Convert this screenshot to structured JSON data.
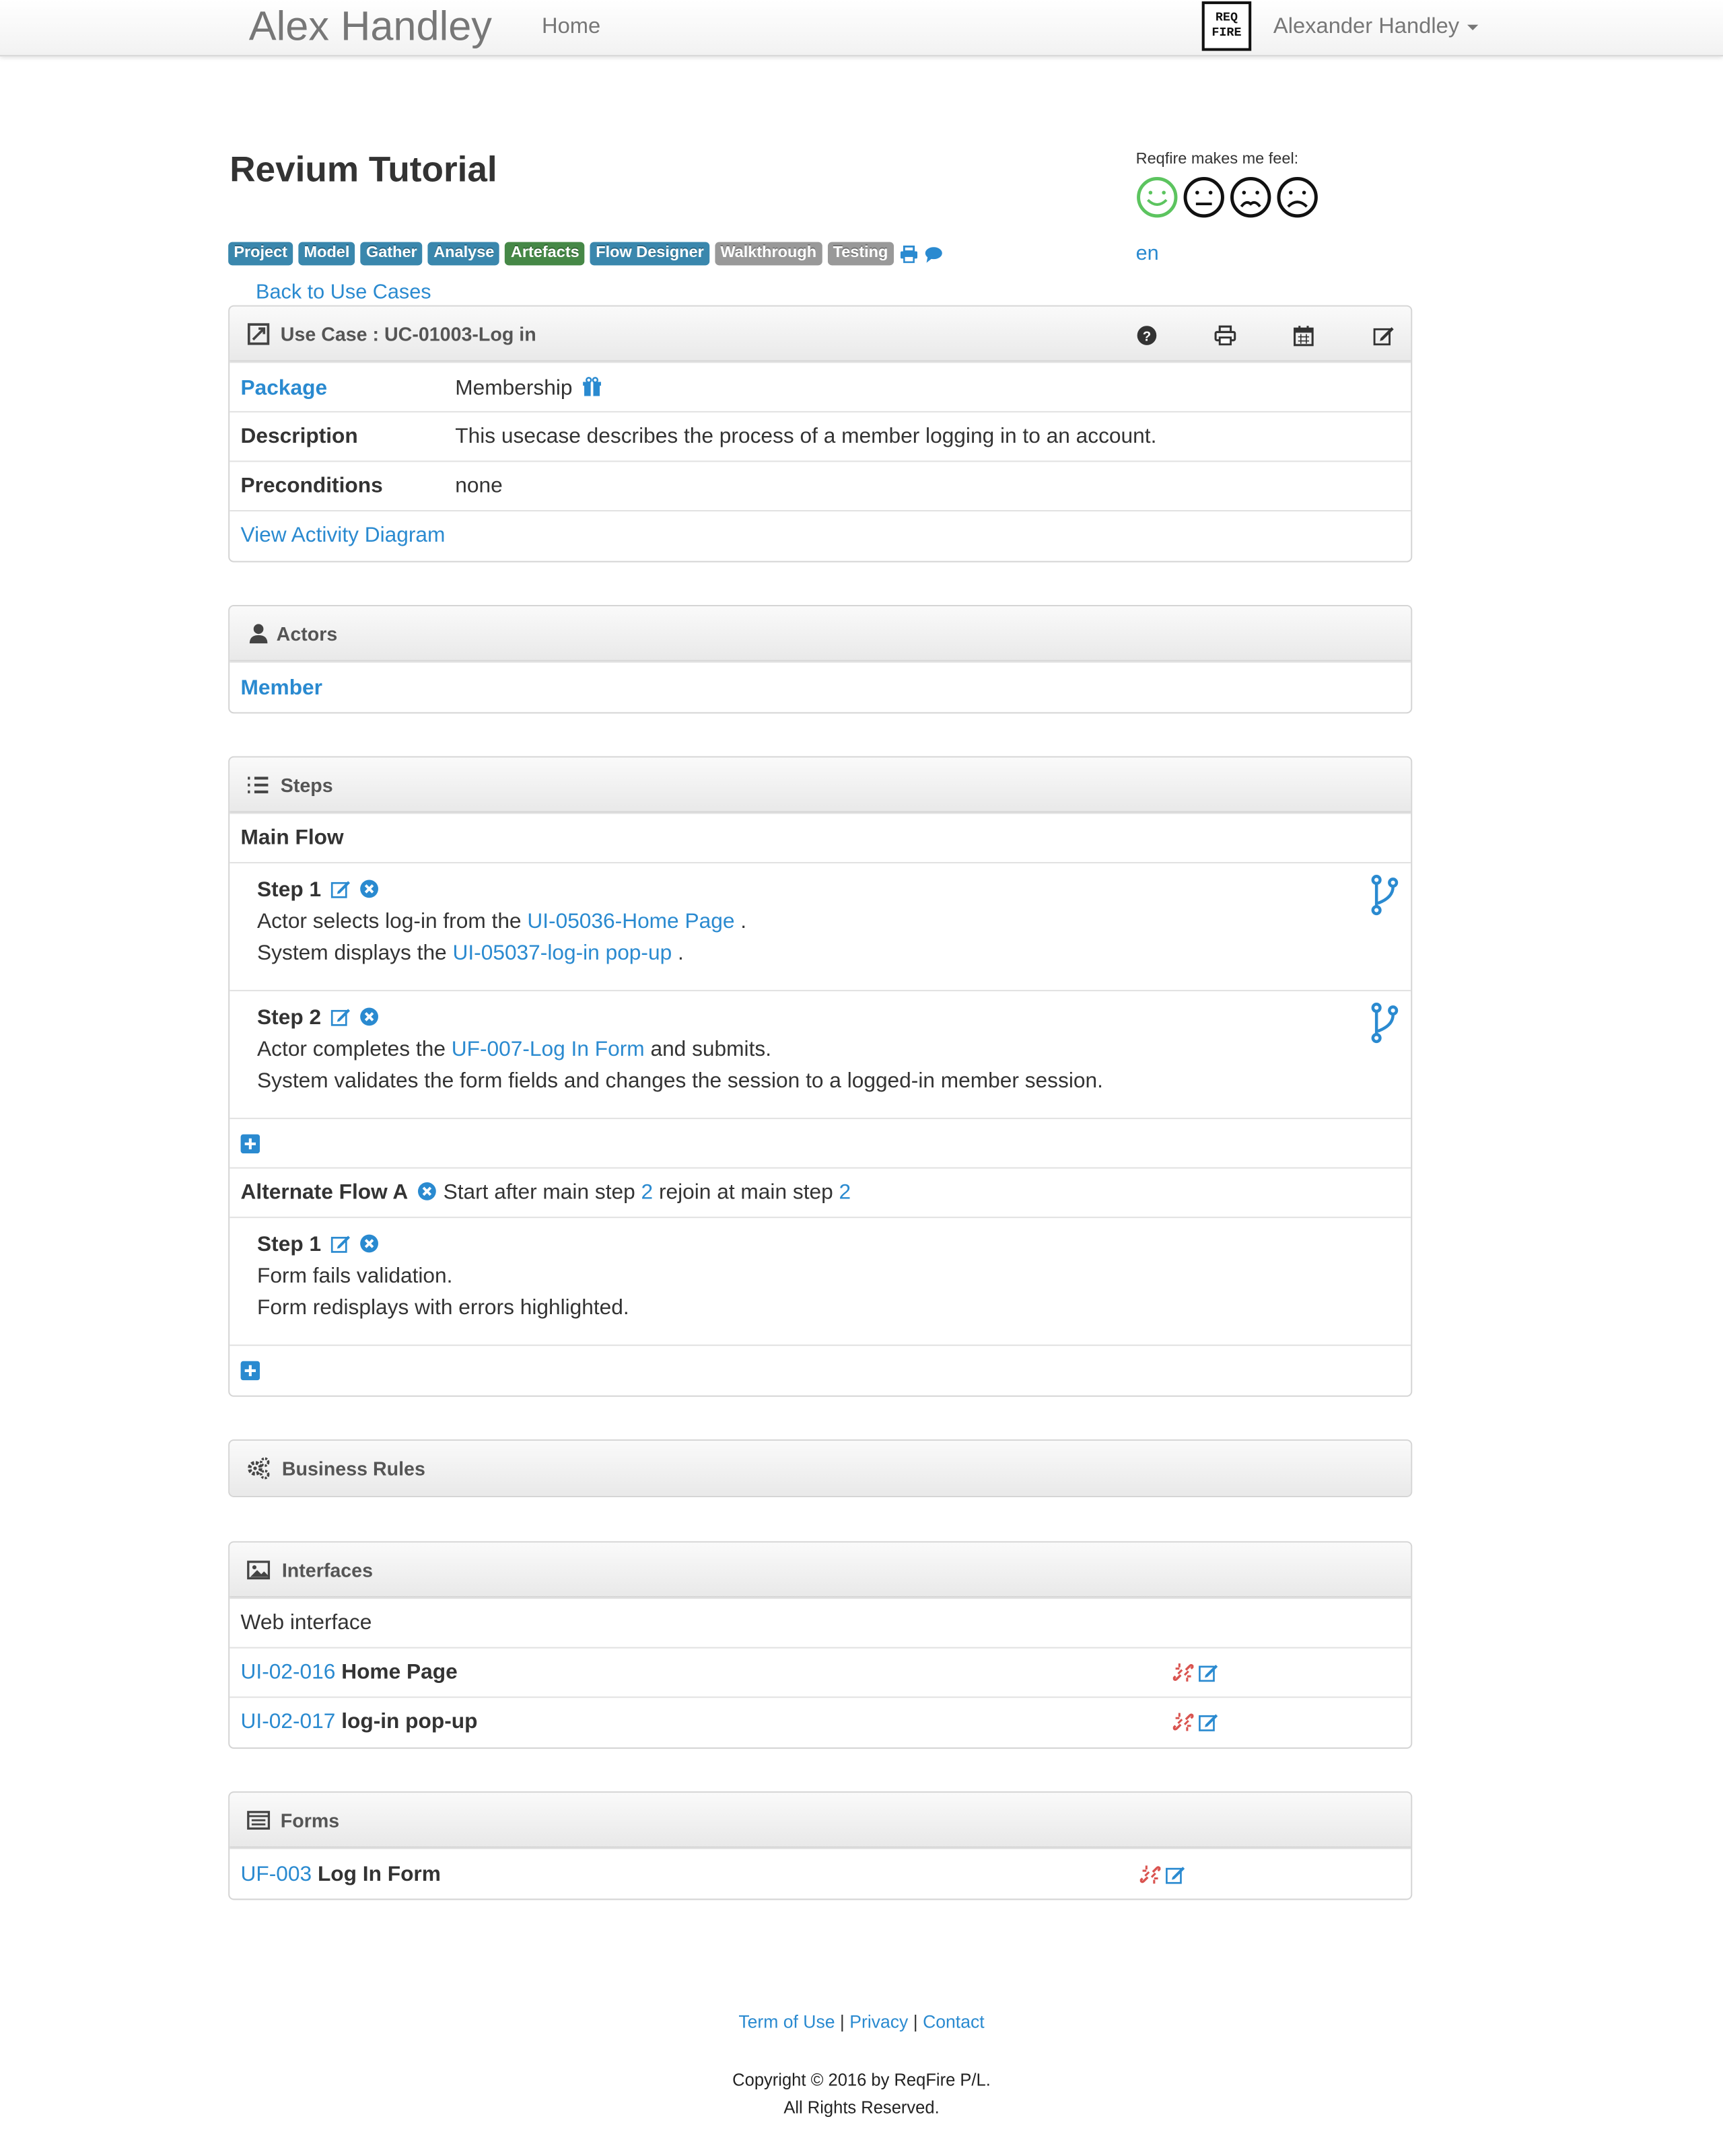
{
  "navbar": {
    "brand": "Alex Handley",
    "home": "Home",
    "logo_text_top": "REQ",
    "logo_text_bottom": "FIRE",
    "user": "Alexander Handley"
  },
  "page": {
    "title": "Revium Tutorial",
    "feel_label": "Reqfire makes me feel:",
    "language": "en",
    "back_link": "Back to Use Cases"
  },
  "labels": [
    {
      "text": "Project",
      "color": "#3a87ad"
    },
    {
      "text": "Model",
      "color": "#3a87ad"
    },
    {
      "text": "Gather",
      "color": "#3a87ad"
    },
    {
      "text": "Analyse",
      "color": "#3a87ad"
    },
    {
      "text": "Artefacts",
      "color": "#468847"
    },
    {
      "text": "Flow Designer",
      "color": "#3a87ad"
    },
    {
      "text": "Walkthrough",
      "color": "#999999"
    },
    {
      "text": "Testing",
      "color": "#999999"
    }
  ],
  "usecase": {
    "header": "Use Case : UC-01003-Log in",
    "package_label": "Package",
    "package_value": "Membership",
    "description_label": "Description",
    "description_value": "This usecase describes the process of a member logging in to an account.",
    "preconditions_label": "Preconditions",
    "preconditions_value": "none",
    "activity_link": "View Activity Diagram"
  },
  "actors": {
    "header": "Actors",
    "member": "Member"
  },
  "steps": {
    "header": "Steps",
    "main_flow": "Main Flow",
    "main": [
      {
        "title": "Step 1",
        "line1_pre": "Actor selects log-in from the",
        "line1_link": "UI-05036-Home Page",
        "line1_post": ".",
        "line2_pre": "System displays the",
        "line2_link": "UI-05037-log-in pop-up",
        "line2_post": "."
      },
      {
        "title": "Step 2",
        "line1_pre": "Actor completes the",
        "line1_link": "UF-007-Log In Form",
        "line1_post": "and submits.",
        "line2": "System validates the form fields and changes the session to a logged-in member session."
      }
    ],
    "alt_flow": {
      "title": "Alternate Flow A",
      "start_text": "Start after main step",
      "start_step": "2",
      "rejoin_text": "rejoin at main step",
      "rejoin_step": "2",
      "step_title": "Step 1",
      "line1": "Form fails validation.",
      "line2": "Form redisplays with errors highlighted."
    }
  },
  "business_rules": {
    "header": "Business Rules"
  },
  "interfaces": {
    "header": "Interfaces",
    "group": "Web interface",
    "items": [
      {
        "id": "UI-02-016",
        "name": "Home Page"
      },
      {
        "id": "UI-02-017",
        "name": "log-in pop-up"
      }
    ]
  },
  "forms": {
    "header": "Forms",
    "items": [
      {
        "id": "UF-003",
        "name": "Log In Form"
      }
    ]
  },
  "footer": {
    "terms": "Term of Use",
    "privacy": "Privacy",
    "contact": "Contact",
    "sep": "|",
    "copyright": "Copyright © 2016 by ReqFire P/L.",
    "rights": "All Rights Reserved."
  },
  "colors": {
    "link": "#2a8ad0",
    "happy_face": "#5cc45f",
    "unlink_red": "#d9534f"
  }
}
